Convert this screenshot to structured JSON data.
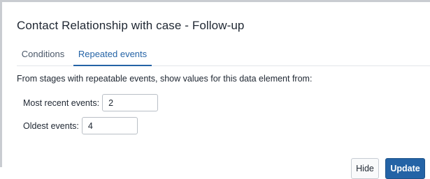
{
  "dialog": {
    "title": "Contact Relationship with case - Follow-up"
  },
  "tabs": [
    {
      "label": "Conditions",
      "active": false
    },
    {
      "label": "Repeated events",
      "active": true
    }
  ],
  "description": "From stages with repeatable events, show values for this data element from:",
  "fields": {
    "most_recent": {
      "label": "Most recent events:",
      "value": "2"
    },
    "oldest": {
      "label": "Oldest events:",
      "value": "4"
    }
  },
  "buttons": {
    "hide": "Hide",
    "update": "Update"
  },
  "colors": {
    "accent": "#2463a6",
    "text": "#212934",
    "muted": "#4a5768"
  }
}
